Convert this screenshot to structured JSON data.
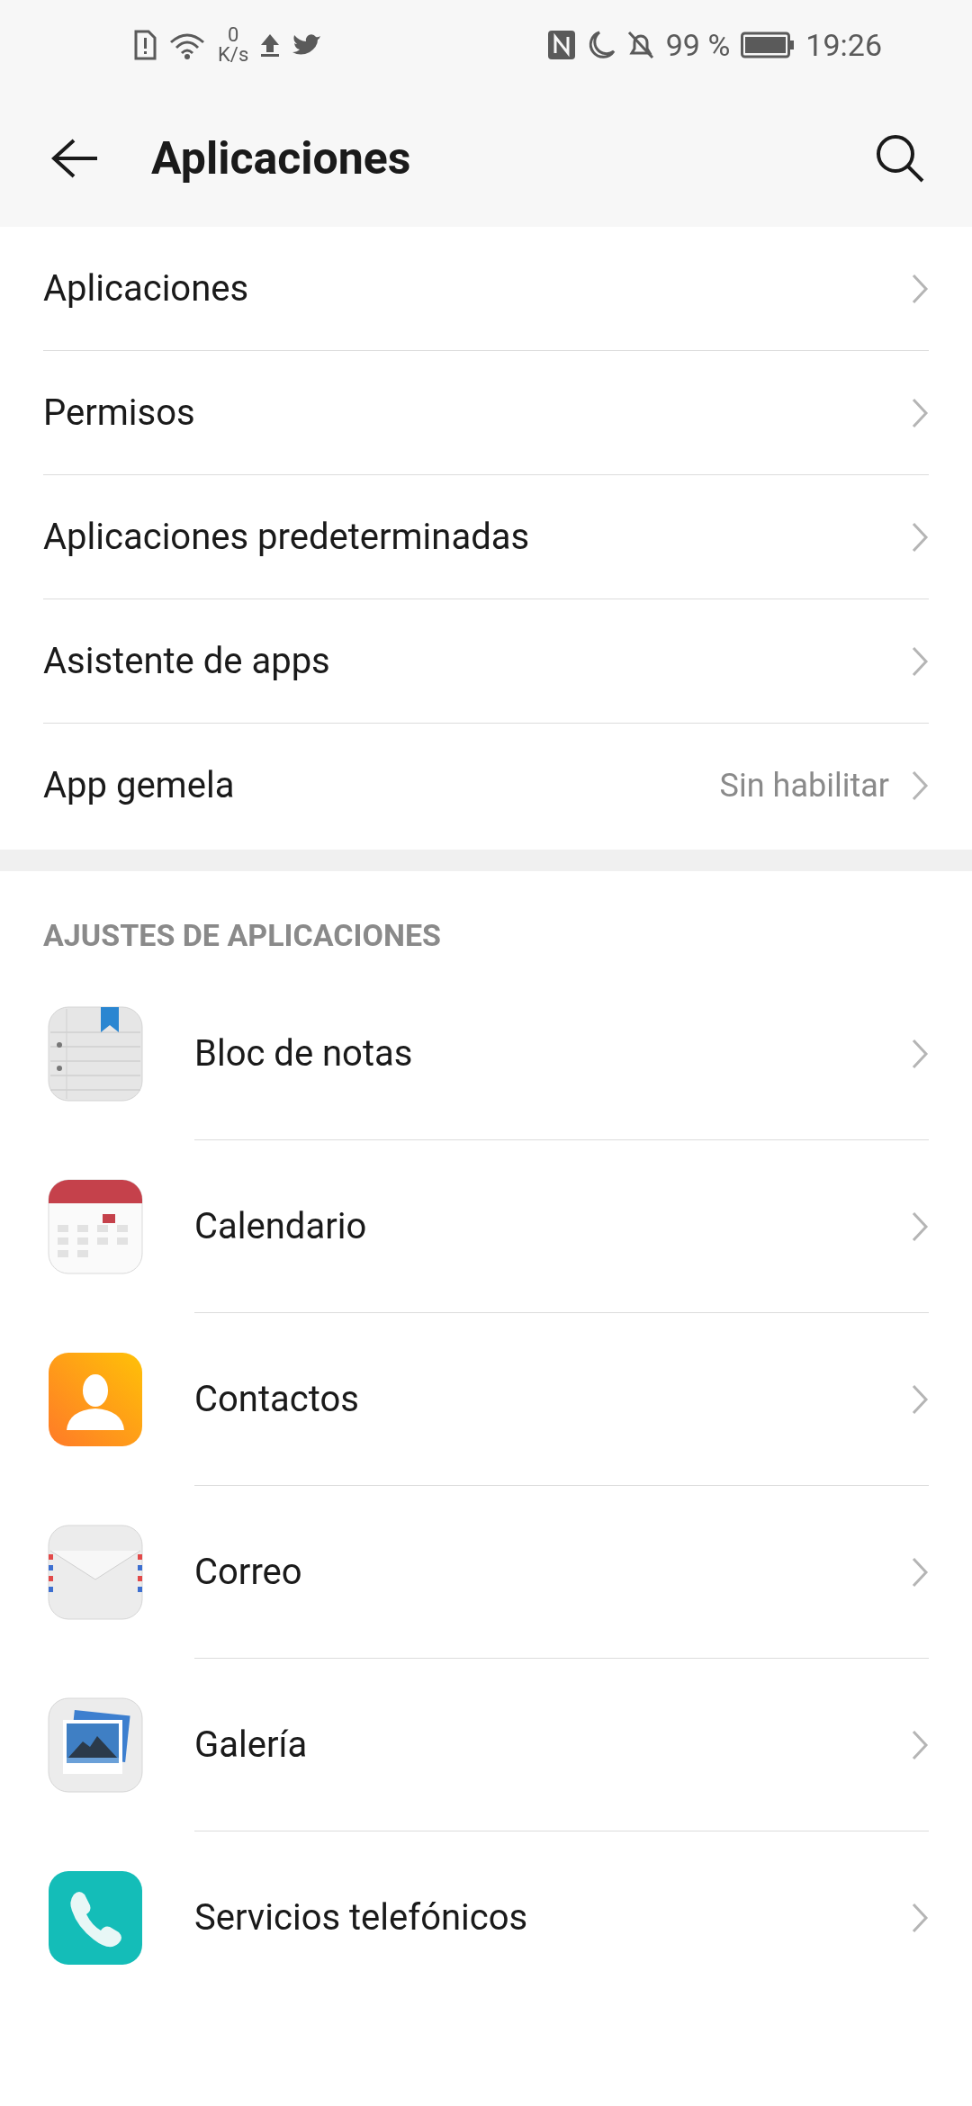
{
  "status_bar": {
    "speed_value": "0",
    "speed_unit": "K/s",
    "battery": "99 %",
    "time": "19:26"
  },
  "header": {
    "title": "Aplicaciones"
  },
  "menu": [
    {
      "label": "Aplicaciones"
    },
    {
      "label": "Permisos"
    },
    {
      "label": "Aplicaciones predeterminadas"
    },
    {
      "label": "Asistente de apps"
    },
    {
      "label": "App gemela",
      "value": "Sin habilitar"
    }
  ],
  "section": {
    "title": "AJUSTES DE APLICACIONES",
    "apps": [
      {
        "label": "Bloc de notas",
        "kind": "notes"
      },
      {
        "label": "Calendario",
        "kind": "calendar"
      },
      {
        "label": "Contactos",
        "kind": "contacts"
      },
      {
        "label": "Correo",
        "kind": "mail"
      },
      {
        "label": "Galería",
        "kind": "gallery"
      },
      {
        "label": "Servicios telefónicos",
        "kind": "phone"
      }
    ]
  }
}
